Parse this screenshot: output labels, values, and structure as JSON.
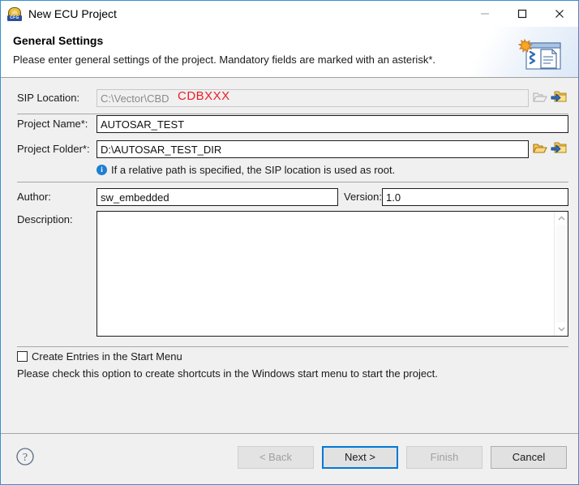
{
  "window": {
    "title": "New ECU Project",
    "app_icon": "ecu-cfg-icon",
    "minimize_label": "—",
    "maximize_label": "□",
    "close_label": "✕"
  },
  "header": {
    "title": "General Settings",
    "subtitle": "Please enter general settings of the project. Mandatory fields are marked with an asterisk*.",
    "banner_icon": "new-project-wizard-icon"
  },
  "form": {
    "sip_location": {
      "label": "SIP Location:",
      "value": "C:\\Vector\\CBD",
      "disabled": true,
      "browse_icon": "open-folder-icon",
      "import_icon": "folder-import-icon"
    },
    "annotation": {
      "text": "CDBXXX",
      "color": "#ee1c25"
    },
    "project_name": {
      "label": "Project Name*:",
      "value": "AUTOSAR_TEST",
      "placeholder": ""
    },
    "project_folder": {
      "label": "Project Folder*:",
      "value": "D:\\AUTOSAR_TEST_DIR",
      "placeholder": "",
      "browse_icon": "open-folder-icon",
      "import_icon": "folder-import-icon"
    },
    "hint": {
      "icon": "info-icon",
      "icon_glyph": "i",
      "text": "If a relative path is specified, the SIP location is used as root."
    },
    "author": {
      "label": "Author:",
      "value": "sw_embedded",
      "placeholder": ""
    },
    "version": {
      "label": "Version:",
      "value": "1.0",
      "placeholder": ""
    },
    "description": {
      "label": "Description:",
      "value": "",
      "placeholder": "",
      "scroll_up_icon": "chevron-up-icon",
      "scroll_down_icon": "chevron-down-icon"
    },
    "start_menu": {
      "label": "Create Entries in the Start Menu",
      "checked": false
    },
    "start_menu_hint": "Please check this option to create shortcuts in the Windows start menu to start the project."
  },
  "footer": {
    "help_icon": "help-question-icon",
    "buttons": [
      {
        "label": "< Back",
        "state": "disabled"
      },
      {
        "label": "Next >",
        "state": "default-focused"
      },
      {
        "label": "Finish",
        "state": "disabled"
      },
      {
        "label": "Cancel",
        "state": "enabled"
      }
    ]
  },
  "colors": {
    "window_border": "#3a8ed0",
    "body_bg": "#f0f0f0",
    "accent": "#0078d7",
    "annotation_red": "#ee1c25",
    "info_blue": "#1f7fd0"
  }
}
